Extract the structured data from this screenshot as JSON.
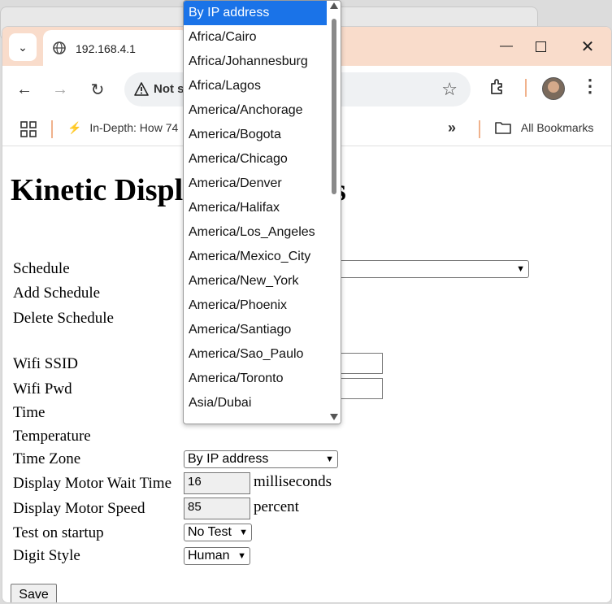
{
  "browser": {
    "tab_title": "192.168.4.1",
    "security_label": "Not s",
    "bookmark_item": "In-Depth: How 74",
    "all_bookmarks": "All Bookmarks",
    "more_glyph": "»"
  },
  "page": {
    "heading": "Kinetic Display  s Settings",
    "labels": {
      "schedule": "Schedule",
      "add_schedule": "Add Schedule",
      "delete_schedule": "Delete Schedule",
      "wifi_ssid": "Wifi SSID",
      "wifi_pwd": "Wifi Pwd",
      "time": "Time",
      "temperature": "Temperature",
      "time_zone": "Time Zone",
      "motor_wait": "Display Motor Wait Time",
      "motor_speed": "Display Motor Speed",
      "test_startup": "Test on startup",
      "digit_style": "Digit Style"
    },
    "values": {
      "time_zone": "By IP address",
      "motor_wait": "16",
      "motor_wait_unit": "milliseconds",
      "motor_speed": "85",
      "motor_speed_unit": "percent",
      "test_startup": "No Test",
      "digit_style": "Human"
    },
    "save_label": "Save"
  },
  "timezone_options": [
    "By IP address",
    "Africa/Cairo",
    "Africa/Johannesburg",
    "Africa/Lagos",
    "America/Anchorage",
    "America/Bogota",
    "America/Chicago",
    "America/Denver",
    "America/Halifax",
    "America/Los_Angeles",
    "America/Mexico_City",
    "America/New_York",
    "America/Phoenix",
    "America/Santiago",
    "America/Sao_Paulo",
    "America/Toronto",
    "Asia/Dubai"
  ],
  "colors": {
    "tabstrip": "#f9dccb",
    "selected_option": "#1a73e8"
  }
}
